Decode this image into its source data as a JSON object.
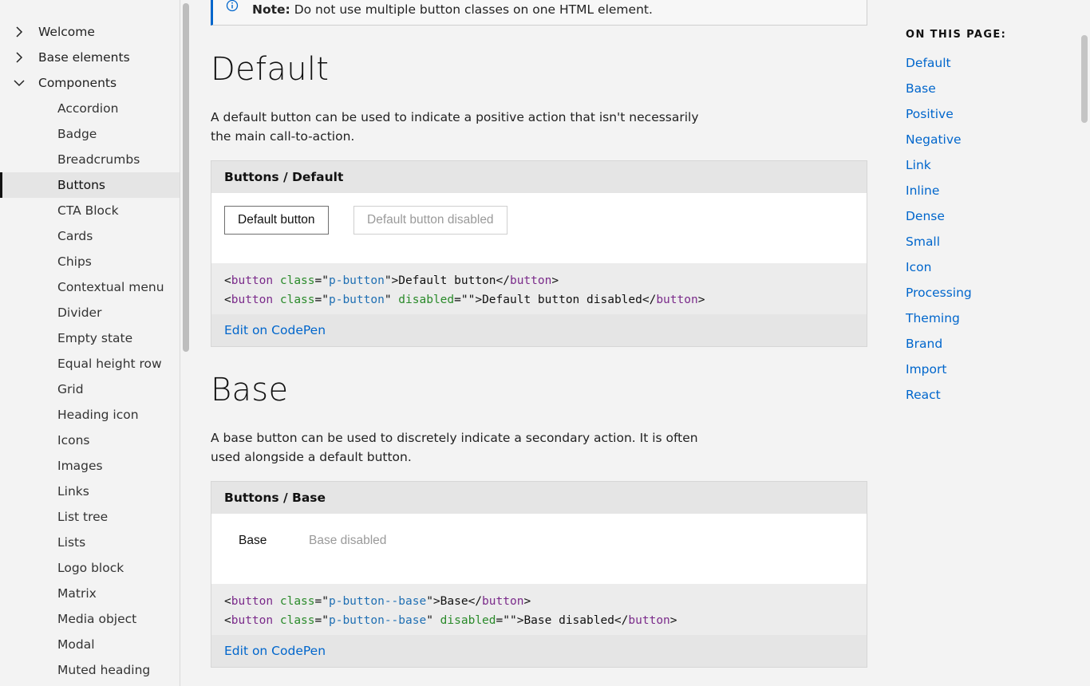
{
  "sidebar": {
    "top_items": [
      {
        "label": "Welcome",
        "expanded": false
      },
      {
        "label": "Base elements",
        "expanded": false
      },
      {
        "label": "Components",
        "expanded": true
      }
    ],
    "sub_items": [
      {
        "label": "Accordion",
        "active": false
      },
      {
        "label": "Badge",
        "active": false
      },
      {
        "label": "Breadcrumbs",
        "active": false
      },
      {
        "label": "Buttons",
        "active": true
      },
      {
        "label": "CTA Block",
        "active": false
      },
      {
        "label": "Cards",
        "active": false
      },
      {
        "label": "Chips",
        "active": false
      },
      {
        "label": "Contextual menu",
        "active": false
      },
      {
        "label": "Divider",
        "active": false
      },
      {
        "label": "Empty state",
        "active": false
      },
      {
        "label": "Equal height row",
        "active": false
      },
      {
        "label": "Grid",
        "active": false
      },
      {
        "label": "Heading icon",
        "active": false
      },
      {
        "label": "Icons",
        "active": false
      },
      {
        "label": "Images",
        "active": false
      },
      {
        "label": "Links",
        "active": false
      },
      {
        "label": "List tree",
        "active": false
      },
      {
        "label": "Lists",
        "active": false
      },
      {
        "label": "Logo block",
        "active": false
      },
      {
        "label": "Matrix",
        "active": false
      },
      {
        "label": "Media object",
        "active": false
      },
      {
        "label": "Modal",
        "active": false
      },
      {
        "label": "Muted heading",
        "active": false
      }
    ]
  },
  "note": {
    "label": "Note:",
    "text": "Do not use multiple button classes on one HTML element."
  },
  "sections": {
    "default": {
      "title": "Default",
      "intro": "A default button can be used to indicate a positive action that isn't necessarily the main call-to-action.",
      "example_title": "Buttons / Default",
      "button_label": "Default button",
      "button_disabled_label": "Default button disabled",
      "code_line1": {
        "t1": "<",
        "tag": "button",
        "sp": " ",
        "attr": "class",
        "eq": "=\"",
        "val": "p-button",
        "close": "\">Default button</",
        "tag2": "button",
        "end": ">"
      },
      "code_line2": {
        "t1": "<",
        "tag": "button",
        "sp": " ",
        "attr": "class",
        "eq": "=\"",
        "val": "p-button",
        "q": "\" ",
        "attr2": "disabled",
        "eq2": "=\"\"",
        "close": ">Default button disabled</",
        "tag2": "button",
        "end": ">"
      },
      "edit_link": "Edit on CodePen"
    },
    "base": {
      "title": "Base",
      "intro": "A base button can be used to discretely indicate a secondary action. It is often used alongside a default button.",
      "example_title": "Buttons / Base",
      "button_label": "Base",
      "button_disabled_label": "Base disabled",
      "code_line1": {
        "t1": "<",
        "tag": "button",
        "sp": " ",
        "attr": "class",
        "eq": "=\"",
        "val": "p-button--base",
        "close": "\">Base</",
        "tag2": "button",
        "end": ">"
      },
      "code_line2": {
        "t1": "<",
        "tag": "button",
        "sp": " ",
        "attr": "class",
        "eq": "=\"",
        "val": "p-button--base",
        "q": "\" ",
        "attr2": "disabled",
        "eq2": "=\"\"",
        "close": ">Base disabled</",
        "tag2": "button",
        "end": ">"
      },
      "edit_link": "Edit on CodePen"
    }
  },
  "toc": {
    "title": "ON THIS PAGE:",
    "links": [
      "Default",
      "Base",
      "Positive",
      "Negative",
      "Link",
      "Inline",
      "Dense",
      "Small",
      "Icon",
      "Processing",
      "Theming",
      "Brand",
      "Import",
      "React"
    ]
  },
  "colors": {
    "link": "#0066cc",
    "tag": "#7a2a8a",
    "attr": "#2a8a2a",
    "value": "#1f6fb3",
    "note_accent": "#0066cc"
  }
}
